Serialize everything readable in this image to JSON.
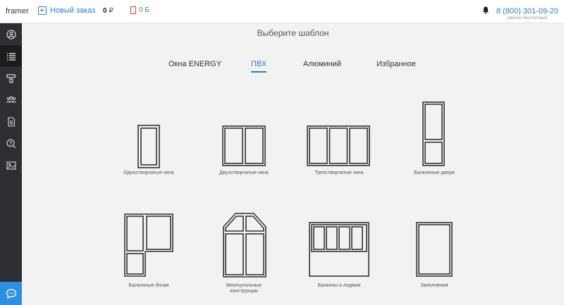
{
  "header": {
    "logo": "framer",
    "new_order": "Новый заказ",
    "balance_value": "0",
    "balance_currency": "₽",
    "bonus": "0 Б",
    "phone": "8 (800) 301-09-20",
    "phone_note": "(звонок бесплатный)"
  },
  "sidebar": {
    "items": [
      {
        "icon": "user-icon"
      },
      {
        "icon": "list-icon",
        "active": true
      },
      {
        "icon": "tool-icon"
      },
      {
        "icon": "users-icon"
      },
      {
        "icon": "document-icon"
      },
      {
        "icon": "help-chat-icon"
      },
      {
        "icon": "image-icon"
      }
    ],
    "chat_icon": "chat-icon"
  },
  "main": {
    "title": "Выберите шаблон",
    "tabs": [
      {
        "label": "Окна ENERGY"
      },
      {
        "label": "ПВХ",
        "active": true
      },
      {
        "label": "Алюминий"
      },
      {
        "label": "Избранное"
      }
    ],
    "templates": [
      {
        "caption": "Одностворчатые окна"
      },
      {
        "caption": "Двухстворчатые окна"
      },
      {
        "caption": "Трехстворчатые окна"
      },
      {
        "caption": "Балконные двери"
      },
      {
        "caption": "Балконные блоки"
      },
      {
        "caption_line1": "Многоугольные",
        "caption_line2": "конструкции"
      },
      {
        "caption": "Балконы и лоджии"
      },
      {
        "caption": "Заполнения"
      }
    ]
  },
  "colors": {
    "accent": "#2e7cc4",
    "sidebar_bg": "#2d2f32",
    "chat_button": "#2e8ee0",
    "bonus_text": "#3a9a3a",
    "bonus_icon": "#dd3333"
  }
}
